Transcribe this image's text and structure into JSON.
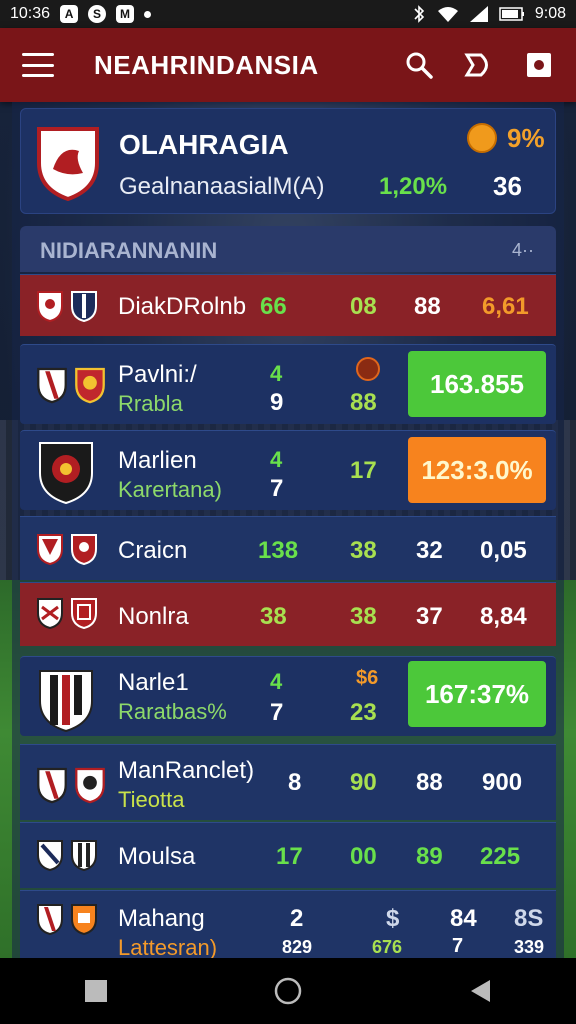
{
  "status_bar": {
    "time_left": "10:36",
    "app_icons": [
      "A",
      "S",
      "M"
    ],
    "time_right": "9:08"
  },
  "app_bar": {
    "title": "NEAHRINDANSIA"
  },
  "hero": {
    "name": "OLAHRAGIA",
    "subtitle": "GealnanaasialM(A)",
    "pct": "9%",
    "rate": "1,20%",
    "value": "36"
  },
  "section": {
    "label": "NIDIARANNANIN",
    "meta": "4··"
  },
  "rows": [
    {
      "name": "DiakDRolnb",
      "cols": [
        "66",
        "08",
        "88",
        "6,61"
      ]
    },
    {
      "name": "Pavlni:/",
      "sub": "Rrabla",
      "top": [
        "4",
        "•"
      ],
      "bottom": [
        "9",
        "88"
      ],
      "pill": "163.855"
    },
    {
      "name": "Marlien",
      "sub": "Karertana)",
      "top": [
        "4",
        ""
      ],
      "bottom": [
        "7",
        "17"
      ],
      "pill": "123:3.0%"
    },
    {
      "name": "Craicn",
      "cols": [
        "138",
        "38",
        "32",
        "0,05"
      ]
    },
    {
      "name": "Nonlra",
      "cols": [
        "38",
        "38",
        "37",
        "8,84"
      ]
    },
    {
      "name": "Narle1",
      "sub": "Raratbas%",
      "top": [
        "4",
        "$6"
      ],
      "bottom": [
        "7",
        "23"
      ],
      "pill": "167:37%"
    },
    {
      "name": "ManRanclet)",
      "sub": "Tieotta",
      "cols": [
        "8",
        "90",
        "88",
        "900"
      ]
    },
    {
      "name": "Moulsa",
      "cols": [
        "17",
        "00",
        "89",
        "225"
      ]
    },
    {
      "name": "Mahang",
      "sub": "Lattesran)",
      "top": [
        "2",
        "$",
        "84",
        "8S"
      ],
      "bottom": [
        "829",
        "676",
        "7",
        "339"
      ]
    }
  ],
  "colors": {
    "app_bar": "#7a1518",
    "accent_green": "#4cc83a",
    "accent_orange": "#f7831e",
    "row_red": "#8a2227",
    "row_blue": "#1f3466"
  }
}
